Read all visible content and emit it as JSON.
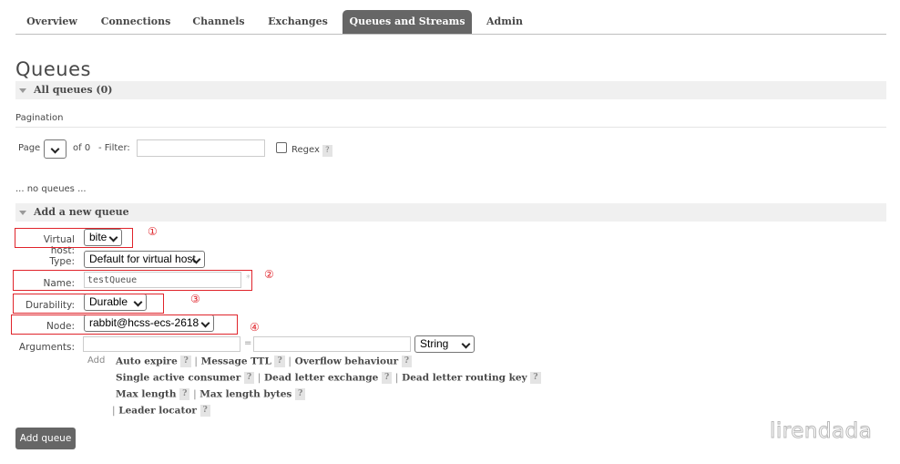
{
  "nav": {
    "tabs": [
      "Overview",
      "Connections",
      "Channels",
      "Exchanges",
      "Queues and Streams",
      "Admin"
    ],
    "active": "Queues and Streams"
  },
  "page_title": "Queues",
  "all_queues": {
    "label": "All queues (0)"
  },
  "pagination": {
    "heading": "Pagination",
    "page_label": "Page",
    "of_label": "of 0",
    "filter_label": "- Filter:",
    "filter_value": "",
    "regex_label": "Regex",
    "help": "?"
  },
  "empty_text": "... no queues ...",
  "add_queue": {
    "section_label": "Add a new queue",
    "virtual_host": {
      "label": "Virtual host:",
      "value": "bite"
    },
    "type": {
      "label": "Type:",
      "value": "Default for virtual host"
    },
    "name": {
      "label": "Name:",
      "value": "testQueue",
      "required_mark": "*"
    },
    "durability": {
      "label": "Durability:",
      "value": "Durable"
    },
    "node": {
      "label": "Node:",
      "value": "rabbit@hcss-ecs-2618"
    },
    "arguments": {
      "label": "Arguments:",
      "key": "",
      "equals": "=",
      "value": "",
      "type_value": "String"
    },
    "add_label": "Add",
    "argument_links": [
      [
        "Auto expire",
        "Message TTL",
        "Overflow behaviour"
      ],
      [
        "Single active consumer",
        "Dead letter exchange",
        "Dead letter routing key"
      ],
      [
        "Max length",
        "Max length bytes"
      ],
      [
        "Leader locator"
      ]
    ],
    "help": "?",
    "separator": "|",
    "submit_label": "Add queue"
  },
  "annotations": [
    "①",
    "②",
    "③",
    "④"
  ],
  "watermark": "lirendada",
  "colors": {
    "tab_active_bg": "#666666",
    "annotation_red": "#e0242b",
    "section_bg": "#f0f0f0"
  }
}
